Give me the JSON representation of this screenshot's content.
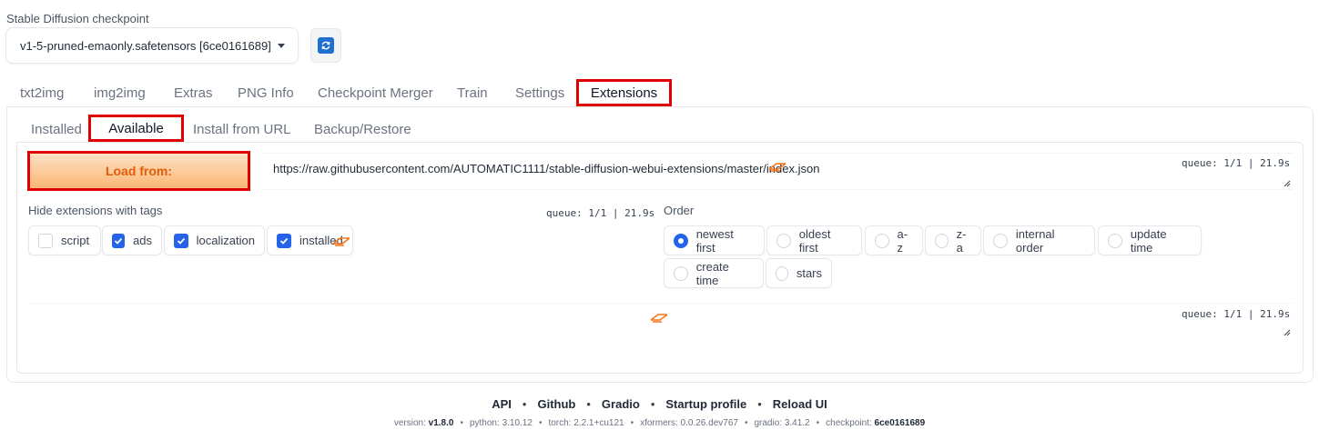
{
  "checkpoint": {
    "label": "Stable Diffusion checkpoint",
    "value": "v1-5-pruned-emaonly.safetensors [6ce0161689]"
  },
  "main_tabs": [
    {
      "label": "txt2img"
    },
    {
      "label": "img2img"
    },
    {
      "label": "Extras"
    },
    {
      "label": "PNG Info"
    },
    {
      "label": "Checkpoint Merger"
    },
    {
      "label": "Train"
    },
    {
      "label": "Settings"
    },
    {
      "label": "Extensions",
      "selected": true
    }
  ],
  "sub_tabs": [
    {
      "label": "Installed"
    },
    {
      "label": "Available",
      "selected": true
    },
    {
      "label": "Install from URL"
    },
    {
      "label": "Backup/Restore"
    }
  ],
  "available": {
    "load_button": "Load from:",
    "url": "https://raw.githubusercontent.com/AUTOMATIC1111/stable-diffusion-webui-extensions/master/index.json",
    "queue_status": "queue: 1/1 | 21.9s",
    "hide_tags_label": "Hide extensions with tags",
    "tags": [
      {
        "label": "script",
        "checked": false
      },
      {
        "label": "ads",
        "checked": true
      },
      {
        "label": "localization",
        "checked": true
      },
      {
        "label": "installed",
        "checked": true
      }
    ],
    "order_label": "Order",
    "order_options": [
      {
        "label": "newest first",
        "selected": true
      },
      {
        "label": "oldest first",
        "selected": false
      },
      {
        "label": "a-z",
        "selected": false
      },
      {
        "label": "z-a",
        "selected": false
      },
      {
        "label": "internal order",
        "selected": false
      },
      {
        "label": "update time",
        "selected": false
      },
      {
        "label": "create time",
        "selected": false
      },
      {
        "label": "stars",
        "selected": false
      }
    ]
  },
  "footer": {
    "links": [
      "API",
      "Github",
      "Gradio",
      "Startup profile",
      "Reload UI"
    ],
    "version": {
      "version_label": "version:",
      "version": "v1.8.0",
      "python_label": "python:",
      "python": "3.10.12",
      "torch_label": "torch:",
      "torch": "2.2.1+cu121",
      "xformers_label": "xformers:",
      "xformers": "0.0.26.dev767",
      "gradio_label": "gradio:",
      "gradio": "3.41.2",
      "checkpoint_label": "checkpoint:",
      "checkpoint": "6ce0161689"
    }
  },
  "colors": {
    "accent_blue": "#2563eb",
    "highlight_red": "#e00000",
    "load_button_text": "#e25c0a",
    "loading_icon": "#f97316"
  }
}
